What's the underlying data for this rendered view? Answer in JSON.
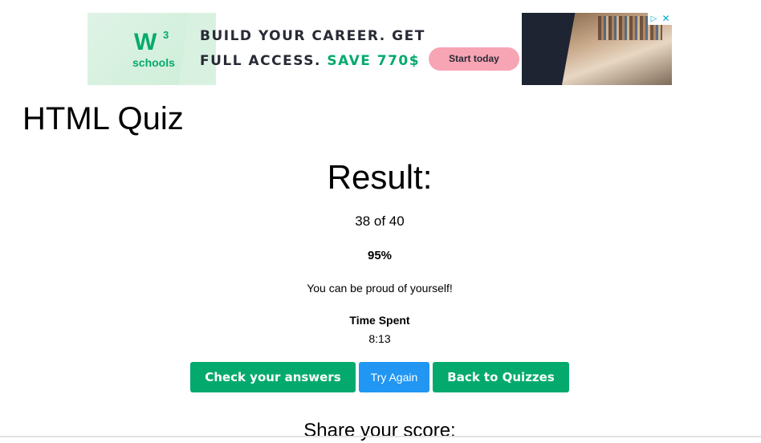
{
  "ad": {
    "logo_w": "W",
    "logo_3": "3",
    "logo_schools": "schools",
    "line1": "BUILD YOUR CAREER. GET",
    "line2_prefix": "FULL ACCESS.",
    "line2_save": "SAVE 770$",
    "cta": "Start today",
    "close": "✕",
    "info": "▷",
    "colors": {
      "brand_green": "#04aa6d",
      "cta_pink": "#f7a4b5",
      "dark": "#282a35"
    }
  },
  "page": {
    "title": "HTML Quiz"
  },
  "result": {
    "heading": "Result:",
    "score": "38 of 40",
    "percent": "95%",
    "message": "You can be proud of yourself!",
    "time_label": "Time Spent",
    "time_value": "8:13"
  },
  "buttons": {
    "check_answers": "Check your answers",
    "try_again": "Try Again",
    "back_to_quizzes": "Back to Quizzes",
    "colors": {
      "green": "#04aa6d",
      "blue": "#2196f3"
    }
  },
  "share": {
    "heading": "Share your score:"
  }
}
